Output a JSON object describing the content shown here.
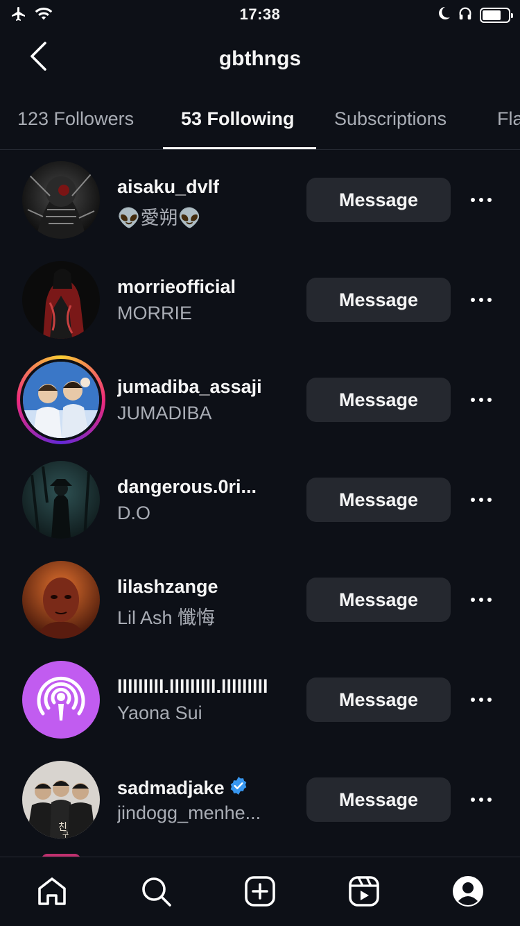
{
  "status_bar": {
    "time": "17:38",
    "left_icons": [
      "airplane-icon",
      "wifi-icon"
    ],
    "right_icons": [
      "moon-icon",
      "headphones-icon",
      "battery-icon"
    ]
  },
  "header": {
    "title": "gbthngs",
    "back_icon": "chevron-left-icon"
  },
  "tabs": [
    {
      "label": "123 Followers",
      "active": false
    },
    {
      "label": "53 Following",
      "active": true
    },
    {
      "label": "Subscriptions",
      "active": false
    },
    {
      "label": "Fla",
      "active": false
    }
  ],
  "list": [
    {
      "username": "aisaku_dvlf",
      "fullname": "👽愛朔👽",
      "button": "Message",
      "verified": false,
      "story_ring": false,
      "avatar_colors": [
        "#2b2b2b",
        "#0c0c0c"
      ]
    },
    {
      "username": "morrieofficial",
      "fullname": "MORRIE",
      "button": "Message",
      "verified": false,
      "story_ring": false,
      "avatar_colors": [
        "#8f1d1d",
        "#0c0c0c"
      ]
    },
    {
      "username": "jumadiba_assaji",
      "fullname": "JUMADIBA",
      "button": "Message",
      "verified": false,
      "story_ring": true,
      "avatar_colors": [
        "#3a77c7",
        "#cfe0f5"
      ]
    },
    {
      "username": "dangerous.0ri...",
      "fullname": "D.O",
      "button": "Message",
      "verified": false,
      "story_ring": false,
      "avatar_colors": [
        "#1f3a3c",
        "#0e1a1c"
      ]
    },
    {
      "username": "lilashzange",
      "fullname": "Lil Ash 懺悔",
      "button": "Message",
      "verified": false,
      "story_ring": false,
      "avatar_colors": [
        "#b8451e",
        "#3d1208"
      ]
    },
    {
      "username": "lllllllll.lllllllll.lllllllll",
      "fullname": "Yaona Sui",
      "button": "Message",
      "verified": false,
      "story_ring": false,
      "avatar_colors": [
        "#c15cf0",
        "#c15cf0"
      ]
    },
    {
      "username": "sadmadjake",
      "fullname": "jindogg_menhe...",
      "button": "Message",
      "verified": true,
      "story_ring": false,
      "avatar_colors": [
        "#d8d4cf",
        "#1b1b1b"
      ]
    }
  ],
  "bottom_nav": [
    {
      "icon": "home-icon"
    },
    {
      "icon": "search-icon"
    },
    {
      "icon": "create-icon"
    },
    {
      "icon": "reels-icon"
    },
    {
      "icon": "profile-icon"
    }
  ],
  "colors": {
    "background": "#0d1017",
    "button_bg": "#25282f",
    "secondary_text": "#a9adb5",
    "verified_blue": "#3897f0",
    "podcast_purple": "#c15cf0"
  }
}
